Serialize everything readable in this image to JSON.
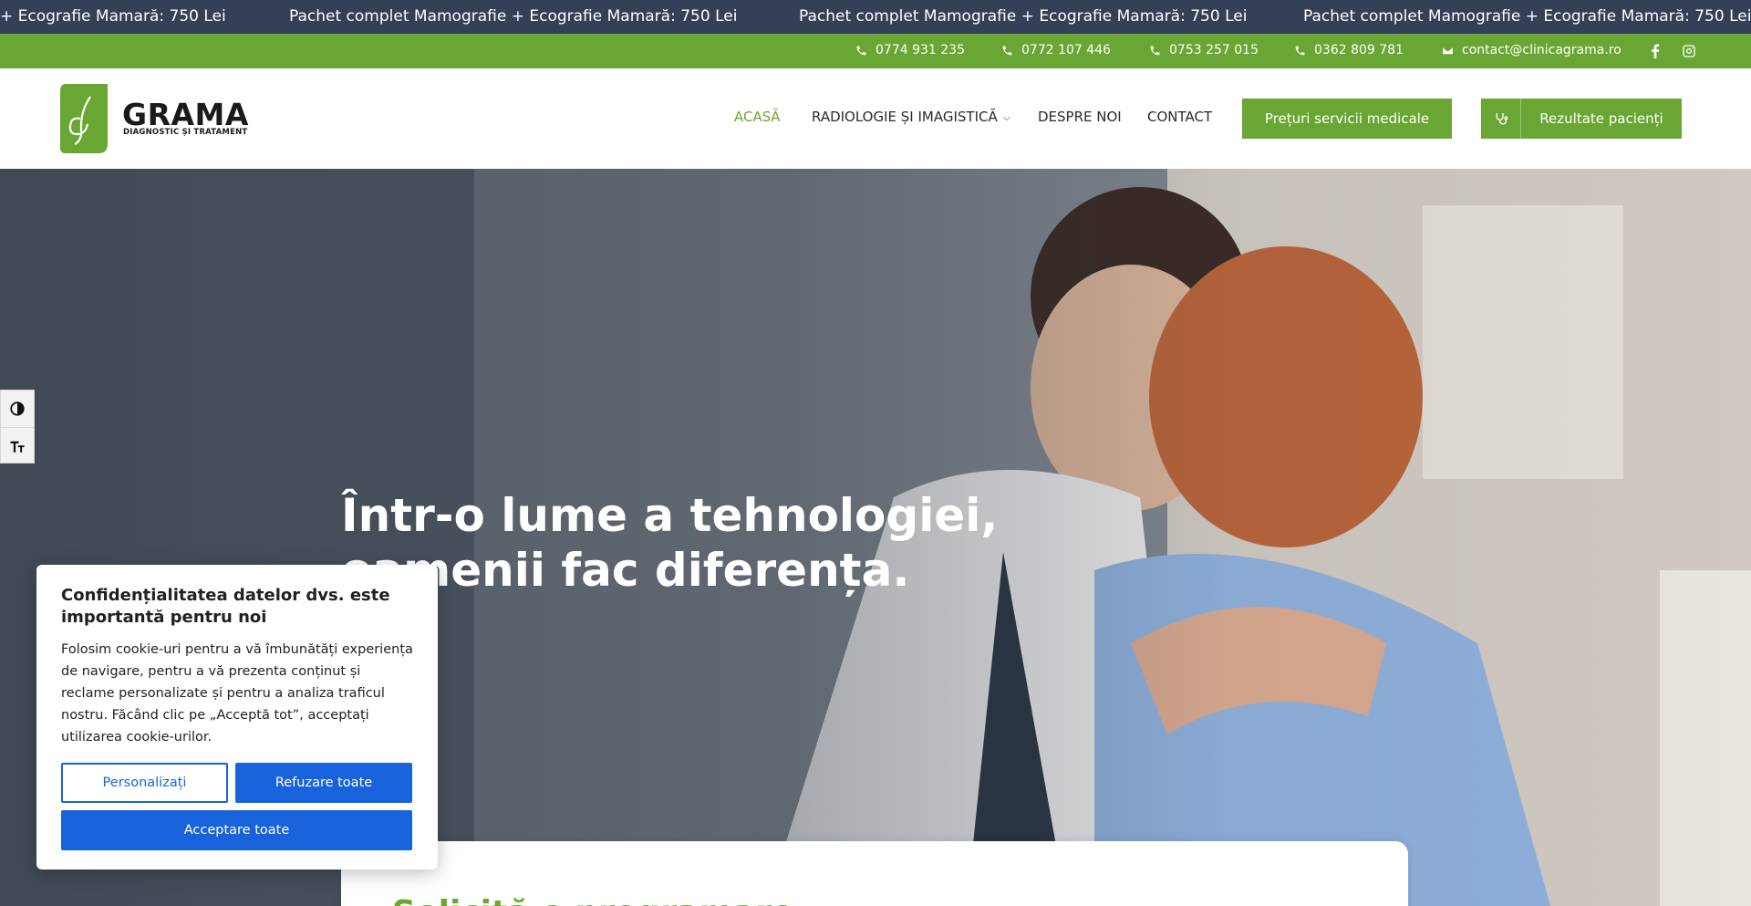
{
  "ticker": {
    "items": [
      "+ Ecografie Mamară: 750 Lei",
      "Pachet complet Mamografie + Ecografie Mamară: 750 Lei",
      "Pachet complet Mamografie + Ecografie Mamară: 750 Lei",
      "Pachet complet Mamografie + Ecografie Mamară: 750 Lei"
    ]
  },
  "contact_bar": {
    "phones": [
      "0774 931 235",
      "0772 107 446",
      "0753 257 015",
      "0362 809 781"
    ],
    "email": "contact@clinicagrama.ro",
    "social": [
      "facebook-icon",
      "instagram-icon"
    ]
  },
  "header": {
    "logo_name": "GRAMA",
    "logo_tagline": "DIAGNOSTIC ȘI TRATAMENT",
    "nav": [
      {
        "label": "ACASĂ",
        "active": true
      },
      {
        "label": "RADIOLOGIE ȘI IMAGISTICĂ",
        "dropdown": true
      },
      {
        "label": "DESPRE NOI"
      },
      {
        "label": "CONTACT"
      }
    ],
    "prices_button": "Prețuri servicii medicale",
    "results_button": "Rezultate pacienți"
  },
  "hero": {
    "title_line1": "Într-o lume a tehnologiei,",
    "title_line2": "oamenii fac diferența."
  },
  "form_card": {
    "title": "Solicită o programare"
  },
  "cookie_banner": {
    "title": "Confidențialitatea datelor dvs. este importantă pentru noi",
    "text": "Folosim cookie-uri pentru a vă îmbunătăți experiența de navigare, pentru a vă prezenta conținut și reclame personalizate și pentru a analiza traficul nostru. Făcând clic pe „Acceptă tot”, acceptați utilizarea cookie-urilor.",
    "customize": "Personalizați",
    "reject": "Refuzare toate",
    "accept": "Acceptare toate"
  },
  "colors": {
    "brand_green": "#6aa633",
    "ticker_bg": "#334056",
    "cookie_blue": "#1863dc"
  }
}
